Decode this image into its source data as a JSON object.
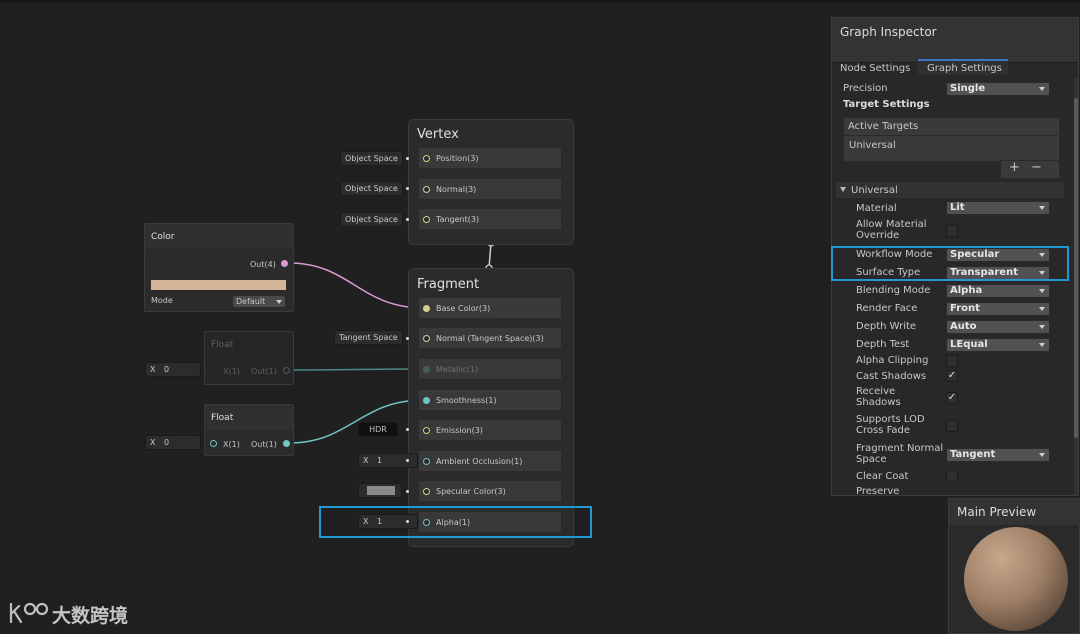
{
  "vertex_node": {
    "title": "Vertex",
    "slots": [
      {
        "label": "Position(3)",
        "input": "Object Space"
      },
      {
        "label": "Normal(3)",
        "input": "Object Space"
      },
      {
        "label": "Tangent(3)",
        "input": "Object Space"
      }
    ]
  },
  "fragment_node": {
    "title": "Fragment",
    "slots": [
      {
        "label": "Base Color(3)"
      },
      {
        "label": "Normal (Tangent Space)(3)",
        "input": "Tangent Space"
      },
      {
        "label": "Metallic(1)"
      },
      {
        "label": "Smoothness(1)"
      },
      {
        "label": "Emission(3)",
        "input": "HDR"
      },
      {
        "label": "Ambient Occlusion(1)",
        "input_axis": "X",
        "input_value": "1"
      },
      {
        "label": "Specular Color(3)"
      },
      {
        "label": "Alpha(1)",
        "input_axis": "X",
        "input_value": "1"
      }
    ]
  },
  "color_node": {
    "title": "Color",
    "output": "Out(4)",
    "mode_label": "Mode",
    "mode_value": "Default",
    "swatch_color": "#d4b59a"
  },
  "float_nodes": [
    {
      "title": "Float",
      "input": "X(1)",
      "output": "Out(1)",
      "axis": "X",
      "value": "0"
    },
    {
      "title": "Float",
      "input": "X(1)",
      "output": "Out(1)",
      "axis": "X",
      "value": "0"
    }
  ],
  "inspector": {
    "title": "Graph Inspector",
    "tabs": [
      "Node Settings",
      "Graph Settings"
    ],
    "precision_label": "Precision",
    "precision_value": "Single",
    "target_settings": "Target Settings",
    "active_targets": "Active Targets",
    "target_item": "Universal",
    "add_icon": "+",
    "remove_icon": "−",
    "section": "Universal",
    "rows": [
      {
        "label": "Material",
        "value": "Lit",
        "type": "dropdown"
      },
      {
        "label": "Allow Material Override",
        "type": "checkbox",
        "checked": false
      },
      {
        "label": "Workflow Mode",
        "value": "Specular",
        "type": "dropdown"
      },
      {
        "label": "Surface Type",
        "value": "Transparent",
        "type": "dropdown"
      },
      {
        "label": "Blending Mode",
        "value": "Alpha",
        "type": "dropdown"
      },
      {
        "label": "Render Face",
        "value": "Front",
        "type": "dropdown"
      },
      {
        "label": "Depth Write",
        "value": "Auto",
        "type": "dropdown"
      },
      {
        "label": "Depth Test",
        "value": "LEqual",
        "type": "dropdown"
      },
      {
        "label": "Alpha Clipping",
        "type": "checkbox",
        "checked": false
      },
      {
        "label": "Cast Shadows",
        "type": "checkbox",
        "checked": true
      },
      {
        "label": "Receive Shadows",
        "type": "checkbox",
        "checked": true
      },
      {
        "label": "Supports LOD Cross Fade",
        "type": "checkbox",
        "checked": false
      },
      {
        "label": "Fragment Normal Space",
        "value": "Tangent",
        "type": "dropdown"
      },
      {
        "label": "Clear Coat",
        "type": "checkbox",
        "checked": false
      },
      {
        "label": "Preserve",
        "type": "checkbox",
        "checked": false
      }
    ]
  },
  "preview": {
    "title": "Main Preview"
  },
  "watermark": "大数跨境",
  "colors": {
    "accent": "#1e9ad6",
    "wire_yellow": "#d6d28a",
    "wire_teal": "#6fc6c4",
    "wire_pink": "#d99bd2"
  }
}
